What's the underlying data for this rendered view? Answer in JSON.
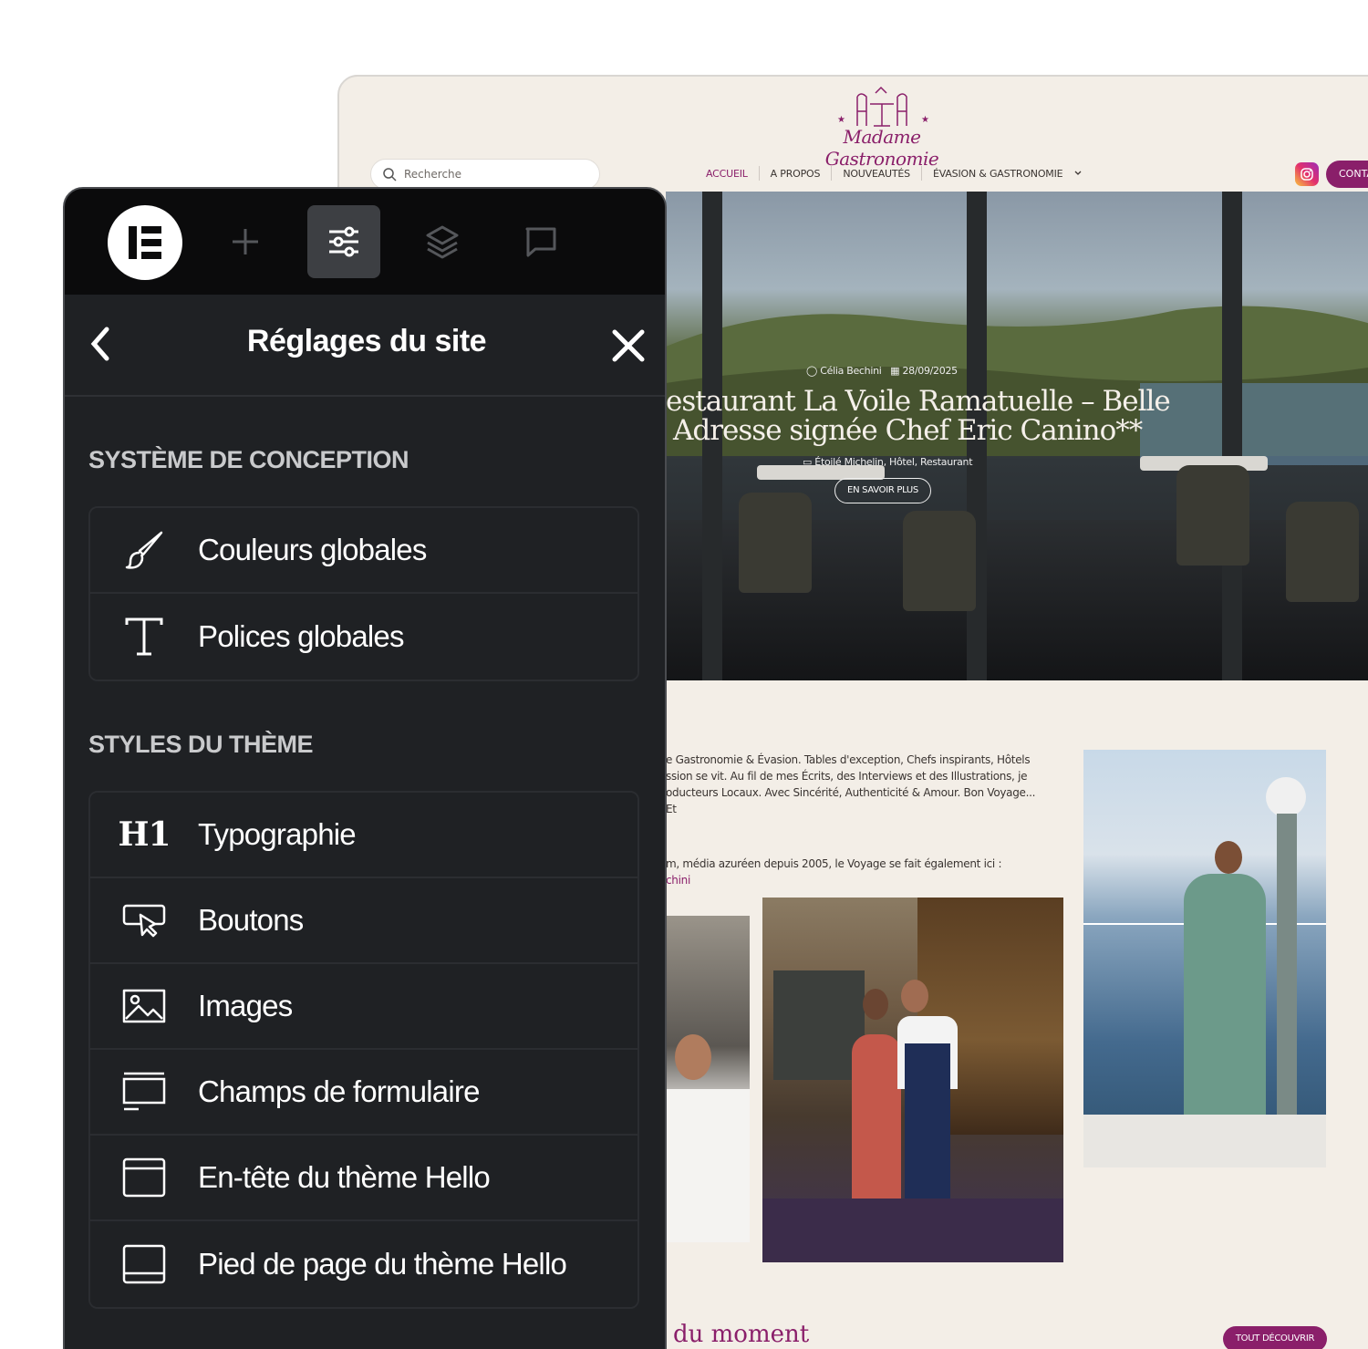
{
  "website": {
    "search_placeholder": "Recherche",
    "logo_text": "Madame Gastronomie",
    "nav": [
      {
        "label": "ACCUEIL",
        "active": true
      },
      {
        "label": "A PROPOS",
        "active": false
      },
      {
        "label": "NOUVEAUTÉS",
        "active": false
      },
      {
        "label": "ÉVASION & GASTRONOMIE",
        "active": false
      }
    ],
    "contact_label": "CONTA",
    "hero": {
      "author": "Célia Bechini",
      "date": "28/09/2025",
      "title_line1": "estaurant La Voile Ramatuelle – Belle",
      "title_line2": "Adresse signée Chef Eric Canino**",
      "categories": "Étoilé Michelin, Hôtel, Restaurant",
      "button": "EN SAVOIR PLUS"
    },
    "about_lines": [
      "e Gastronomie & Évasion. Tables d'exception, Chefs inspirants, Hôtels",
      "ssion se vit. Au fil de mes Écrits, des Interviews et des Illustrations, je",
      "oducteurs Locaux. Avec Sincérité, Authenticité & Amour. Bon Voyage... Et"
    ],
    "about2_line": "m, média azuréen depuis 2005, le Voyage se fait également ici :",
    "about2_link": "chini",
    "section_title": "du moment",
    "all_button": "TOUT DÉCOUVRIR",
    "colors": {
      "brand": "#8a1f6a",
      "background": "#f3eee7"
    }
  },
  "panel": {
    "title": "Réglages du site",
    "toolbar_icons": [
      "elementor-logo",
      "add-icon",
      "site-settings-icon",
      "layers-icon",
      "comments-icon"
    ],
    "sections": [
      {
        "label": "SYSTÈME DE CONCEPTION",
        "items": [
          {
            "label": "Couleurs globales",
            "icon": "brush-icon"
          },
          {
            "label": "Polices globales",
            "icon": "font-icon"
          }
        ]
      },
      {
        "label": "STYLES DU THÈME",
        "items": [
          {
            "label": "Typographie",
            "icon": "h1-icon",
            "icon_text": "H1"
          },
          {
            "label": "Boutons",
            "icon": "button-icon"
          },
          {
            "label": "Images",
            "icon": "image-icon"
          },
          {
            "label": "Champs de formulaire",
            "icon": "form-field-icon"
          },
          {
            "label": "En-tête du thème Hello",
            "icon": "header-icon"
          },
          {
            "label": "Pied de page du thème Hello",
            "icon": "footer-icon"
          }
        ]
      }
    ],
    "colors": {
      "panel_bg": "#1f2124",
      "topbar_bg": "#0b0b0c",
      "text": "#ffffff"
    }
  }
}
